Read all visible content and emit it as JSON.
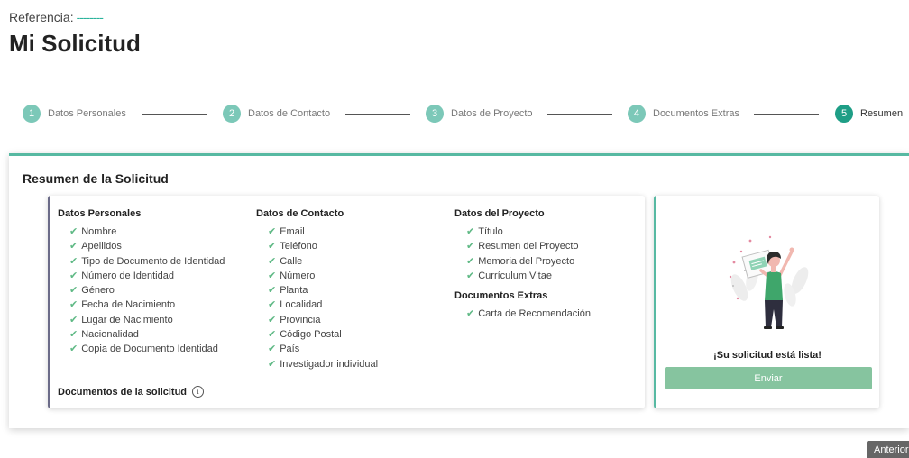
{
  "header": {
    "reference_label": "Referencia:",
    "reference_value": "--------",
    "title": "Mi Solicitud"
  },
  "stepper": {
    "steps": [
      {
        "number": "1",
        "label": "Datos Personales",
        "active": false
      },
      {
        "number": "2",
        "label": "Datos de Contacto",
        "active": false
      },
      {
        "number": "3",
        "label": "Datos de Proyecto",
        "active": false
      },
      {
        "number": "4",
        "label": "Documentos Extras",
        "active": false
      },
      {
        "number": "5",
        "label": "Resumen",
        "active": true
      }
    ]
  },
  "summary": {
    "title": "Resumen de la Solicitud",
    "personal": {
      "heading": "Datos Personales",
      "items": [
        "Nombre",
        "Apellidos",
        "Tipo de Documento de Identidad",
        "Número de Identidad",
        "Género",
        "Fecha de Nacimiento",
        "Lugar de Nacimiento",
        "Nacionalidad",
        "Copia de Documento Identidad"
      ]
    },
    "contact": {
      "heading": "Datos de Contacto",
      "items": [
        "Email",
        "Teléfono",
        "Calle",
        "Número",
        "Planta",
        "Localidad",
        "Provincia",
        "Código Postal",
        "País",
        "Investigador individual"
      ]
    },
    "project": {
      "heading": "Datos del Proyecto",
      "items": [
        "Título",
        "Resumen del Proyecto",
        "Memoria del Proyecto",
        "Currículum Vitae"
      ]
    },
    "extras": {
      "heading": "Documentos Extras",
      "items": [
        "Carta de Recomendación"
      ]
    },
    "documents_label": "Documentos de la solicitud",
    "check_glyph": "✔",
    "info_glyph": "i"
  },
  "ready_panel": {
    "message": "¡Su solicitud está lista!",
    "send_label": "Enviar"
  },
  "footer": {
    "previous_label": "Anterior"
  },
  "colors": {
    "accent": "#57b9a2",
    "step_inactive": "#7cc8b8",
    "step_active": "#1e9e86",
    "check": "#5fb985",
    "send_button": "#86c49f",
    "illustration_shirt": "#3fa66b"
  }
}
